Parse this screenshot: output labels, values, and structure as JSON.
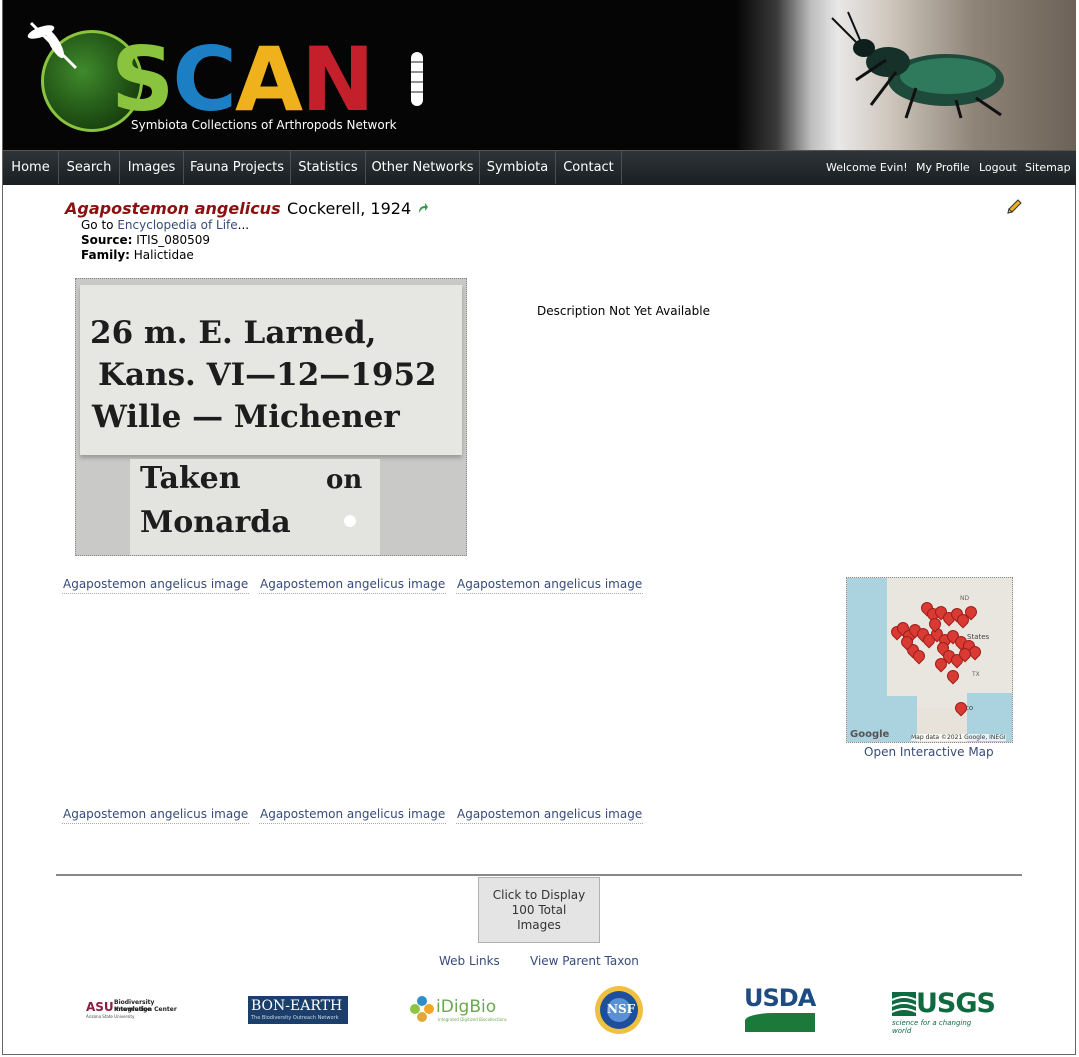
{
  "header": {
    "logo_text": "SCAN",
    "logo_subtitle": "Symbiota Collections of Arthropods Network"
  },
  "nav": {
    "items": [
      "Home",
      "Search",
      "Images",
      "Fauna Projects",
      "Statistics",
      "Other Networks",
      "Symbiota",
      "Contact"
    ],
    "welcome": "Welcome Evin!",
    "my_profile": "My Profile",
    "logout": "Logout",
    "sitemap": "Sitemap"
  },
  "taxon": {
    "sciname": "Agapostemon angelicus",
    "author": "Cockerell, 1924",
    "goto_prefix": "Go to",
    "goto_link": "Encyclopedia of Life",
    "goto_suffix": "...",
    "source_label": "Source:",
    "source_value": "ITIS_080509",
    "family_label": "Family:",
    "family_value": "Halictidae"
  },
  "main_image": {
    "label_line1": "26 m. E. Larned,",
    "label_line2": "Kans. VI—12—1952",
    "label_line3": "Wille — Michener",
    "label2_line1": "Taken",
    "label2_word": "on",
    "label2_line2": "Monarda"
  },
  "description": "Description Not Yet Available",
  "thumbnails": {
    "row1": [
      "Agapostemon angelicus image",
      "Agapostemon angelicus image",
      "Agapostemon angelicus image"
    ],
    "row2": [
      "Agapostemon angelicus image",
      "Agapostemon angelicus image",
      "Agapostemon angelicus image"
    ]
  },
  "map": {
    "google_label": "Google",
    "attribution": "Map data ©2021 Google, INEGI",
    "label_nd": "ND",
    "label_states": "States",
    "label_tx": "TX",
    "label_mexico": "co",
    "caption": "Open Interactive Map"
  },
  "footer": {
    "display_line1": "Click to Display",
    "display_line2": "100 Total",
    "display_line3": "Images",
    "web_links": "Web Links",
    "parent_taxon": "View Parent Taxon"
  },
  "partners": {
    "asu": "ASU",
    "asu_line1": "Biodiversity Knowledge",
    "asu_line2": "Integration Center",
    "asu_line3": "Arizona State University",
    "bon_earth": "BON-EARTH",
    "bon_sub": "The Biodiversity Outreach Network",
    "idigbio": "iDigBio",
    "idigbio_sub": "Integrated Digitized Biocollections",
    "nsf": "NSF",
    "usda": "USDA",
    "usgs": "USGS",
    "usgs_sub": "science for a changing world"
  }
}
